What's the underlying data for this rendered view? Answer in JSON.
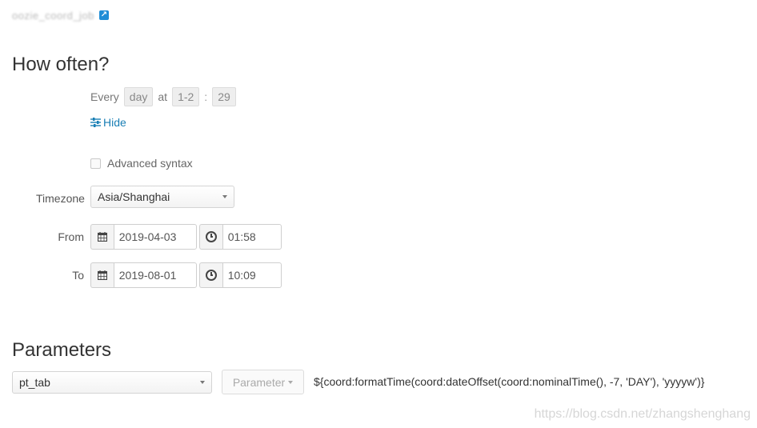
{
  "header": {
    "link_text": "oozie_coord_job",
    "external_icon": "external-link-icon"
  },
  "how_often": {
    "title": "How often?",
    "every_label": "Every",
    "frequency_value": "day",
    "at_label": "at",
    "hour_value": "1-2",
    "separator": ":",
    "minute_value": "29",
    "hide_label": "Hide",
    "advanced_label": "Advanced syntax",
    "advanced_checked": false
  },
  "timezone": {
    "label": "Timezone",
    "value": "Asia/Shanghai"
  },
  "from": {
    "label": "From",
    "date": "2019-04-03",
    "time": "01:58"
  },
  "to": {
    "label": "To",
    "date": "2019-08-01",
    "time": "10:09"
  },
  "parameters": {
    "title": "Parameters",
    "name": "pt_tab",
    "button_label": "Parameter",
    "expression": "${coord:formatTime(coord:dateOffset(coord:nominalTime(), -7, 'DAY'), 'yyyyw')}"
  },
  "watermark": "https://blog.csdn.net/zhangshenghang"
}
